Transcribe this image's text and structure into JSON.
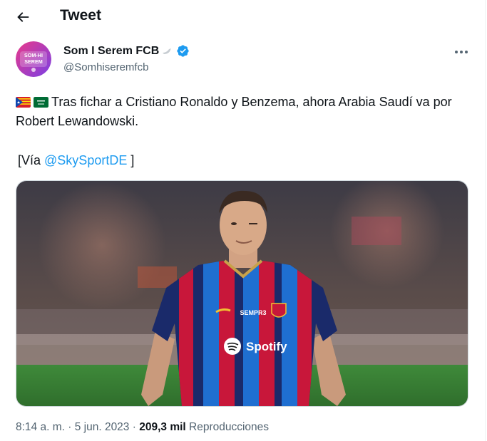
{
  "header": {
    "title": "Tweet",
    "back_icon": "arrow-left-icon"
  },
  "author": {
    "name": "Som I Serem FCB",
    "handle": "@Somhiseremfcb",
    "avatar_text": "SOM-HI SEREM",
    "verified_icon": "verified-badge-icon",
    "emoji_icon": "bird-icon"
  },
  "tweet": {
    "flags": [
      "flag-catalonia-icon",
      "flag-saudi-arabia-icon"
    ],
    "text": "Tras fichar a Cristiano Ronaldo y Benzema, ahora Arabia Saudí va por Robert Lewandowski.",
    "via_prefix": "[Vía ",
    "via_mention": "@SkySportDE",
    "via_suffix": " ]"
  },
  "media": {
    "jersey_sponsor": "Spotify",
    "jersey_brand": "SEMPR3"
  },
  "footer": {
    "time": "8:14 a. m.",
    "sep1": " · ",
    "date": "5 jun. 2023",
    "sep2": " · ",
    "views_count": "209,3 mil",
    "views_label": " Reproducciones"
  },
  "colors": {
    "accent": "#1d9bf0",
    "text": "#0f1419",
    "muted": "#536471"
  }
}
